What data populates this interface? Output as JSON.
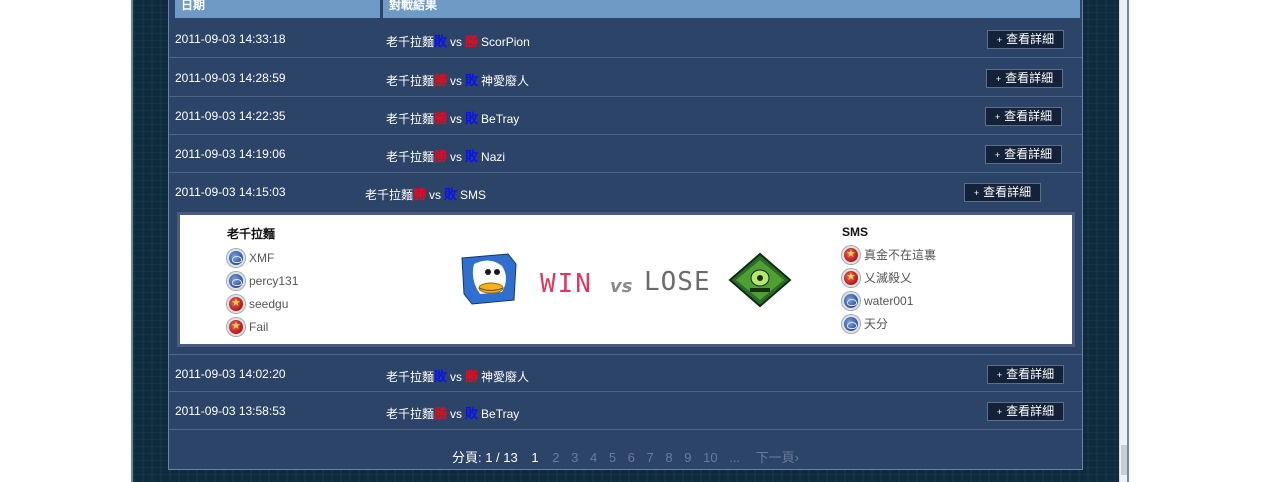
{
  "header": {
    "col_date": "日期",
    "col_result": "對戰結果"
  },
  "rows": [
    {
      "date": "2011-09-03 14:33:18",
      "player": "老千拉麵",
      "player_mark": "敗",
      "vs": "vs",
      "opp_mark": "勝",
      "opponent": "ScorPion",
      "button": "查看詳細"
    },
    {
      "date": "2011-09-03 14:28:59",
      "player": "老千拉麵",
      "player_mark": "勝",
      "vs": "vs",
      "opp_mark": "敗",
      "opponent": "神愛廢人",
      "button": "查看詳細"
    },
    {
      "date": "2011-09-03 14:22:35",
      "player": "老千拉麵",
      "player_mark": "勝",
      "vs": "vs",
      "opp_mark": "敗",
      "opponent": "BeTray",
      "button": "查看詳細"
    },
    {
      "date": "2011-09-03 14:19:06",
      "player": "老千拉麵",
      "player_mark": "勝",
      "vs": "vs",
      "opp_mark": "敗",
      "opponent": "Nazi",
      "button": "查看詳細"
    },
    {
      "date": "2011-09-03 14:15:03",
      "player": "老千拉麵",
      "player_mark": "勝",
      "vs": "vs",
      "opp_mark": "敗",
      "opponent": "SMS",
      "button": "查看詳細"
    },
    {
      "date": "2011-09-03 14:02:20",
      "player": "老千拉麵",
      "player_mark": "敗",
      "vs": "vs",
      "opp_mark": "勝",
      "opponent": "神愛廢人",
      "button": "查看詳細"
    },
    {
      "date": "2011-09-03 13:58:53",
      "player": "老千拉麵",
      "player_mark": "勝",
      "vs": "vs",
      "opp_mark": "敗",
      "opponent": "BeTray",
      "button": "查看詳細"
    }
  ],
  "detail": {
    "left_team": "老千拉麵",
    "left_players": [
      {
        "name": "XMF",
        "badge": "blue"
      },
      {
        "name": "percy131",
        "badge": "blue"
      },
      {
        "name": "seedgu",
        "badge": "red"
      },
      {
        "name": "Fail",
        "badge": "red"
      }
    ],
    "right_team": "SMS",
    "right_players": [
      {
        "name": "真金不在這裏",
        "badge": "red"
      },
      {
        "name": "乂滅殺乂",
        "badge": "red"
      },
      {
        "name": "water001",
        "badge": "blue"
      },
      {
        "name": "天分",
        "badge": "blue"
      }
    ],
    "win_text": "WIN",
    "vs_text": "vs",
    "lose_text": "LOSE"
  },
  "pager": {
    "label": "分頁:",
    "current_of_total": "1 / 13",
    "current": "1",
    "pages": [
      "2",
      "3",
      "4",
      "5",
      "6",
      "7",
      "8",
      "9",
      "10"
    ],
    "ellipsis": "...",
    "next": "下一頁›"
  },
  "colors": {
    "win": "#e8091b",
    "lose": "#0a14f0",
    "panel": "#2d4469",
    "header": "#6f9ac6"
  }
}
